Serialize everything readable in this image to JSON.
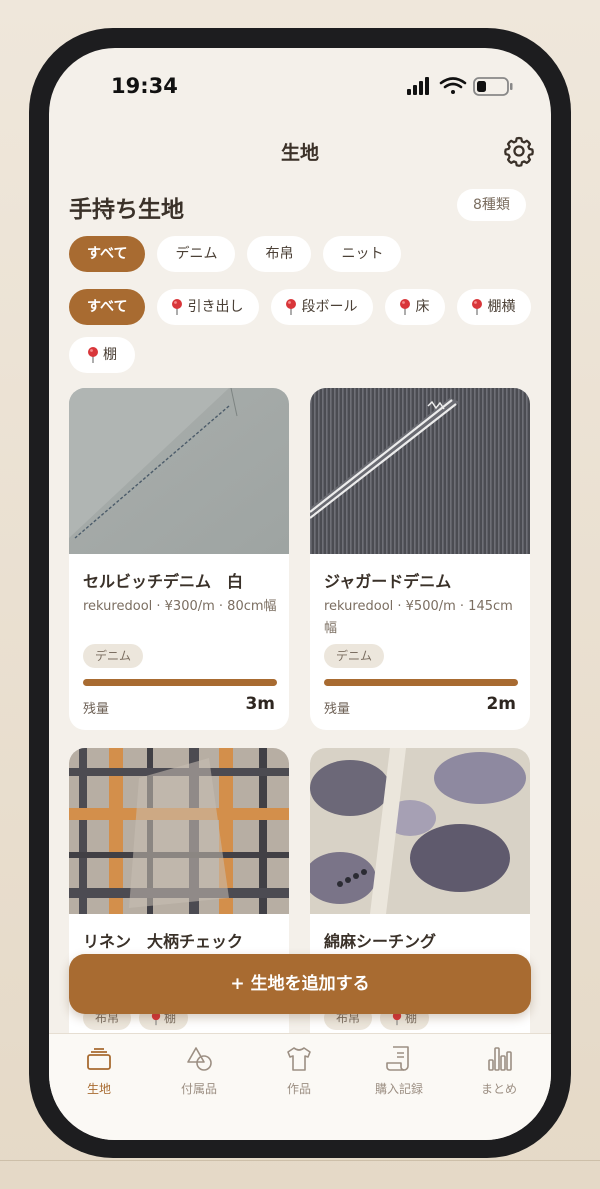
{
  "status_bar": {
    "time": "19:34"
  },
  "header": {
    "title": "生地",
    "settings_icon": "gear-icon"
  },
  "section": {
    "title": "手持ち生地",
    "count_badge": "8種類"
  },
  "category_filters": [
    {
      "label": "すべて",
      "active": true
    },
    {
      "label": "デニム",
      "active": false
    },
    {
      "label": "布帛",
      "active": false
    },
    {
      "label": "ニット",
      "active": false
    }
  ],
  "location_filters": [
    {
      "label": "すべて",
      "active": true,
      "icon": ""
    },
    {
      "label": "引き出し",
      "active": false,
      "icon": "pin-icon"
    },
    {
      "label": "段ボール",
      "active": false,
      "icon": "pin-icon"
    },
    {
      "label": "床",
      "active": false,
      "icon": "pin-icon"
    },
    {
      "label": "棚横",
      "active": false,
      "icon": "pin-icon"
    },
    {
      "label": "棚",
      "active": false,
      "icon": "pin-icon"
    }
  ],
  "fabrics": [
    {
      "name": "セルビッチデニム　白",
      "meta": "rekuredool · ¥300/m · 80cm幅",
      "tag": "デニム",
      "remaining_label": "残量",
      "remaining": "3m",
      "remaining_fraction": 1.0
    },
    {
      "name": "ジャガードデニム",
      "meta": "rekuredool · ¥500/m · 145cm幅",
      "tag": "デニム",
      "remaining_label": "残量",
      "remaining": "2m",
      "remaining_fraction": 1.0
    },
    {
      "name": "リネン　大柄チェック",
      "tag": "布帛",
      "location": "棚"
    },
    {
      "name": "綿麻シーチング",
      "tag": "布帛",
      "location": "棚"
    }
  ],
  "add_button": {
    "label": "+ 生地を追加する"
  },
  "tabs": [
    {
      "label": "生地",
      "icon": "fabric-stack-icon",
      "active": true
    },
    {
      "label": "付属品",
      "icon": "shapes-icon",
      "active": false
    },
    {
      "label": "作品",
      "icon": "tshirt-icon",
      "active": false
    },
    {
      "label": "購入記録",
      "icon": "receipt-icon",
      "active": false
    },
    {
      "label": "まとめ",
      "icon": "bar-chart-icon",
      "active": false
    }
  ],
  "colors": {
    "accent": "#a86b31",
    "background": "#f4f0ea",
    "card": "#ffffff",
    "tag_bg": "#ece6dc"
  }
}
